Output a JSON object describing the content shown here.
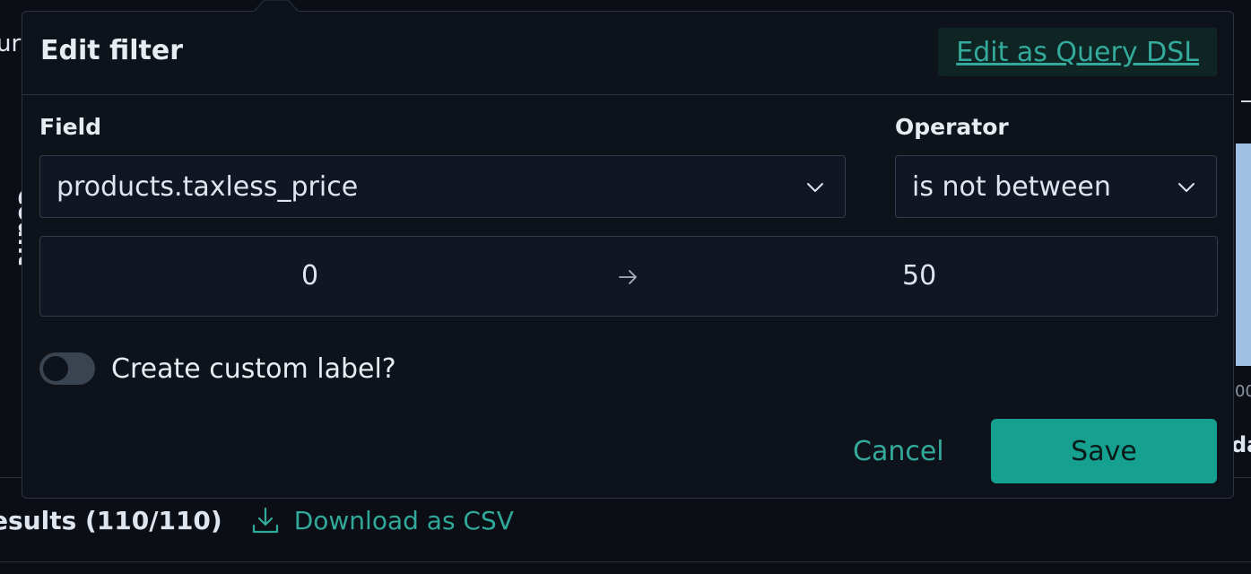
{
  "background": {
    "left_fragment": "ur",
    "axis_label": "Count",
    "right_small": "00",
    "right_bold": "da",
    "results_count": "esults (110/110)",
    "download_label": "Download as CSV"
  },
  "popover": {
    "title": "Edit filter",
    "dsl_link": "Edit as Query DSL",
    "field": {
      "label": "Field",
      "value": "products.taxless_price"
    },
    "operator": {
      "label": "Operator",
      "value": "is not between"
    },
    "range": {
      "from": "0",
      "to": "50"
    },
    "custom_label_toggle": {
      "label": "Create custom label?",
      "checked": false
    },
    "cancel_label": "Cancel",
    "save_label": "Save"
  },
  "colors": {
    "accent": "#16a08f",
    "link": "#33aa9b",
    "panel_bg": "#0e131b",
    "page_bg": "#0b0e14"
  }
}
